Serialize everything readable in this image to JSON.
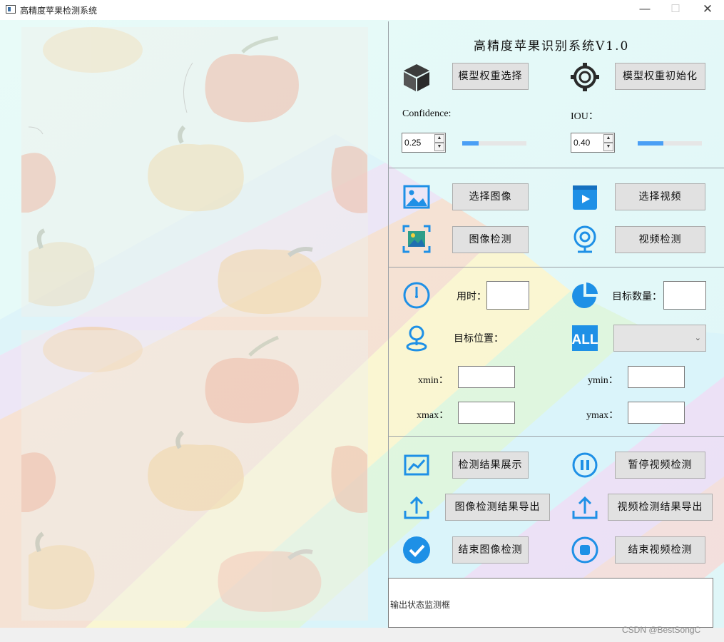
{
  "window": {
    "title": "高精度苹果检测系统",
    "min_glyph": "—",
    "max_glyph": "☐",
    "close_glyph": "✕"
  },
  "panel": {
    "title": "高精度苹果识别系统V1.0",
    "model": {
      "select_weights": "模型权重选择",
      "init_weights": "模型权重初始化"
    },
    "params": {
      "confidence_label": "Confidence:",
      "confidence_value": "0.25",
      "confidence_level": 0.25,
      "iou_label": "IOU：",
      "iou_value": "0.40",
      "iou_level": 0.4
    },
    "media": {
      "select_image": "选择图像",
      "select_video": "选择视频",
      "detect_image": "图像检测",
      "detect_video": "视频检测"
    },
    "results": {
      "time_label": "用时：",
      "count_label": "目标数量：",
      "position_label": "目标位置：",
      "xmin_label": "xmin：",
      "ymin_label": "ymin：",
      "xmax_label": "xmax：",
      "ymax_label": "ymax：",
      "all_icon_text": "ALL"
    },
    "actions": {
      "show_results": "检测结果展示",
      "pause_video": "暂停视频检测",
      "export_image": "图像检测结果导出",
      "export_video": "视频检测结果导出",
      "end_image": "结束图像检测",
      "end_video": "结束视频检测"
    },
    "status_placeholder": "输出状态监测框"
  },
  "watermark": "CSDN @BestSongC",
  "colors": {
    "accent_blue": "#1e90e6",
    "slider_blue": "#4a9ff5",
    "button_gray": "#e1e1e1"
  }
}
